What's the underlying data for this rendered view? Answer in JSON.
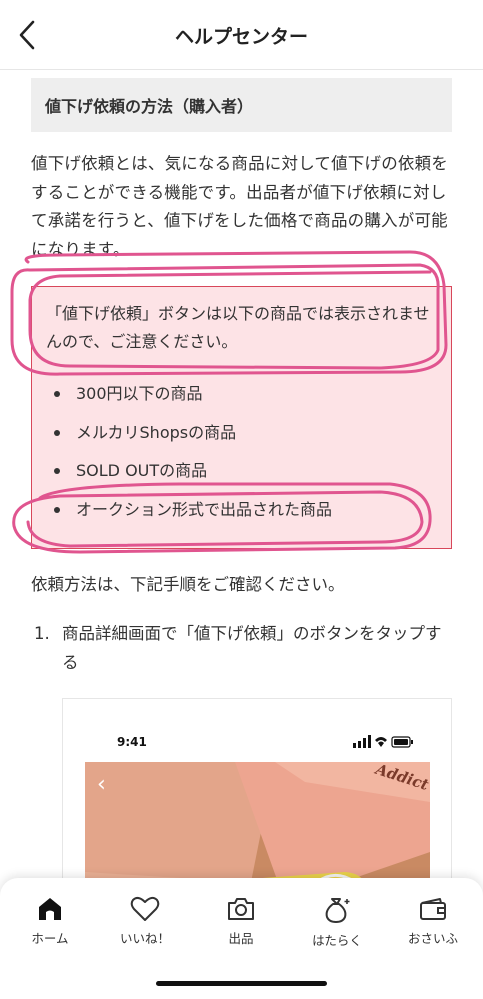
{
  "header": {
    "title": "ヘルプセンター"
  },
  "article": {
    "heading": "値下げ依頼の方法（購入者）",
    "intro": "値下げ依頼とは、気になる商品に対して値下げの依頼をすることができる機能です。出品者が値下げ依頼に対して承諾を行うと、値下げをした価格で商品の購入が可能になります。",
    "notice": {
      "text": "「値下げ依頼」ボタンは以下の商品では表示されませんので、ご注意ください。",
      "items": [
        {
          "label": "300円以下の商品"
        },
        {
          "label": "メルカリShopsの商品"
        },
        {
          "label": "SOLD OUTの商品"
        },
        {
          "label": "オークション形式で出品された商品"
        }
      ]
    },
    "request_method": "依頼方法は、下記手順をご確認ください。",
    "steps": [
      {
        "num": "1.",
        "text": "商品詳細画面で「値下げ依頼」のボタンをタップする"
      }
    ],
    "screenshot": {
      "time": "9:41",
      "brand": "Addict"
    }
  },
  "tabbar": {
    "tabs": [
      {
        "label": "ホーム",
        "icon": "home-icon",
        "active": true
      },
      {
        "label": "いいね！",
        "icon": "heart-icon"
      },
      {
        "label": "出品",
        "icon": "camera-icon"
      },
      {
        "label": "はたらく",
        "icon": "money-bag-icon"
      },
      {
        "label": "おさいふ",
        "icon": "wallet-icon"
      }
    ]
  },
  "colors": {
    "annotation": "#e0558f",
    "notice_bg": "#fde3e6",
    "notice_border": "#d8475a"
  }
}
